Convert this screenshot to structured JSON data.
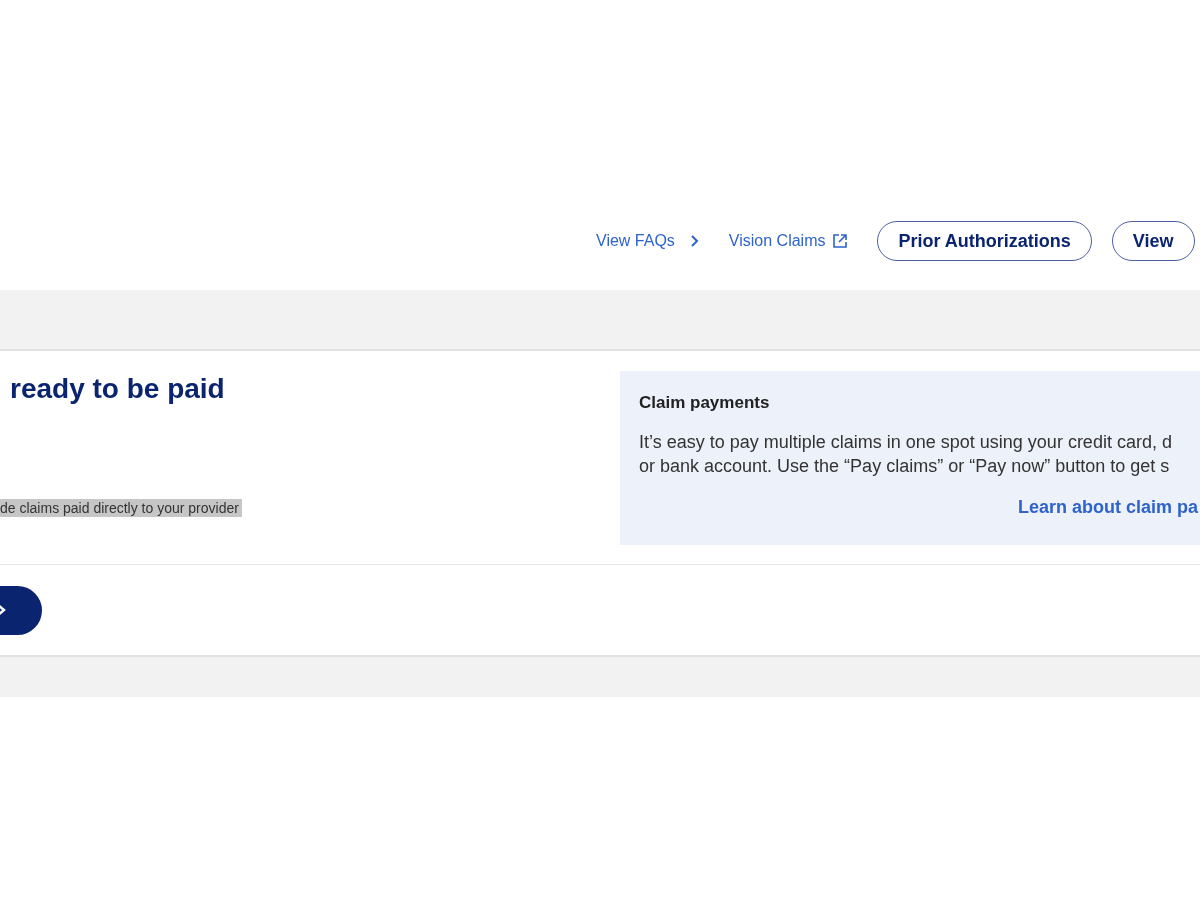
{
  "links": [
    {
      "label": "View FAQs",
      "kind": "chevron"
    },
    {
      "label": "Vision Claims",
      "kind": "external"
    }
  ],
  "buttons": [
    {
      "label": "Prior Authorizations"
    },
    {
      "label": "View"
    }
  ],
  "section": {
    "heading": "ready to be paid",
    "note": "de claims paid directly to your provider",
    "note_highlighted": true
  },
  "info_panel": {
    "title": "Claim payments",
    "body_lines": [
      "It’s easy to pay multiple claims in one spot using your credit card, d",
      "or bank account. Use the “Pay claims” or “Pay now” button to get s"
    ],
    "link": "Learn about claim pa"
  }
}
